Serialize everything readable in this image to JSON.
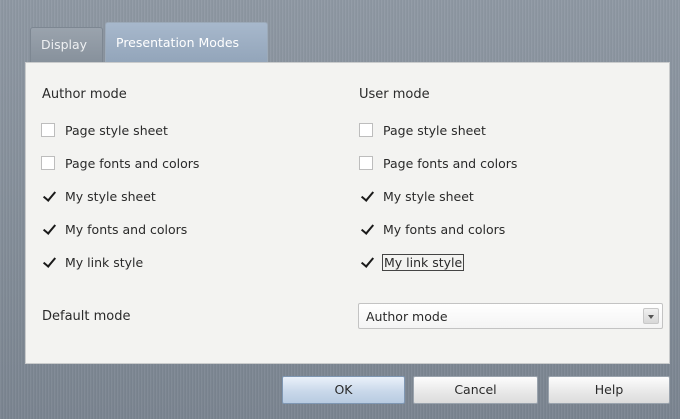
{
  "tabs": {
    "display": "Display",
    "presentation_modes": "Presentation Modes",
    "active": "Presentation Modes"
  },
  "author": {
    "title": "Author mode",
    "options": [
      {
        "label": "Page style sheet",
        "checked": false
      },
      {
        "label": "Page fonts and colors",
        "checked": false
      },
      {
        "label": "My style sheet",
        "checked": true
      },
      {
        "label": "My fonts and colors",
        "checked": true
      },
      {
        "label": "My link style",
        "checked": true
      }
    ]
  },
  "user": {
    "title": "User mode",
    "options": [
      {
        "label": "Page style sheet",
        "checked": false
      },
      {
        "label": "Page fonts and colors",
        "checked": false
      },
      {
        "label": "My style sheet",
        "checked": true
      },
      {
        "label": "My fonts and colors",
        "checked": true
      },
      {
        "label": "My link style",
        "checked": true,
        "focused": true
      }
    ]
  },
  "default_mode": {
    "label": "Default mode",
    "value": "Author mode"
  },
  "buttons": {
    "ok": "OK",
    "cancel": "Cancel",
    "help": "Help"
  },
  "icons": {
    "checkbox_checked": "checkmark-icon",
    "select_arrow": "chevron-down-icon"
  }
}
